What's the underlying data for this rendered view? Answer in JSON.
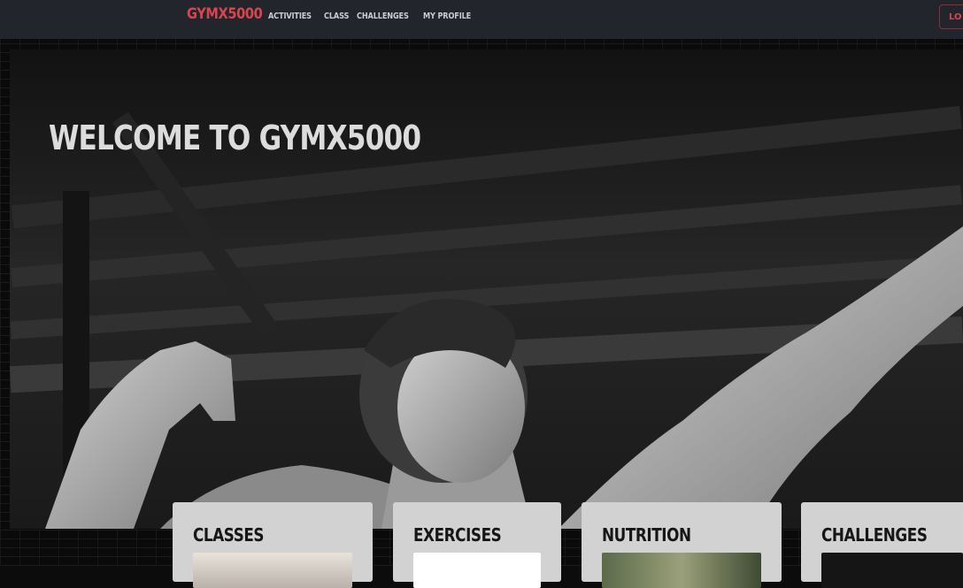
{
  "navbar": {
    "brand": "GYMX5000",
    "links": [
      "ACTIVITIES",
      "CLASS",
      "CHALLENGES",
      "MY PROFILE"
    ],
    "login_label": "LO"
  },
  "hero": {
    "title": "WELCOME TO GYMX5000",
    "image": "black-and-white bodybuilder photo"
  },
  "cards": [
    {
      "title": "CLASSES",
      "image": "classroom photo"
    },
    {
      "title": "EXERCISES",
      "image": "white placeholder"
    },
    {
      "title": "NUTRITION",
      "image": "food photo"
    },
    {
      "title": "CHALLENGES",
      "image": "dark photo"
    }
  ],
  "colors": {
    "navbar_bg": "#22252c",
    "brand": "#d9454f",
    "card_bg": "#d2d2d2"
  }
}
